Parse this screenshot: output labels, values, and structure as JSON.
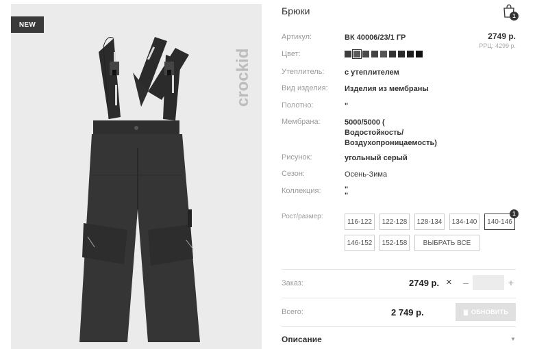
{
  "badge": "NEW",
  "brand_logo": "crockid",
  "product": {
    "title": "Брюки",
    "cart_count": "1",
    "price": "2749 р.",
    "rrp": "РРЦ: 4299 р."
  },
  "specs": [
    {
      "label": "Артикул:",
      "value": "ВК 40006/23/1 ГР"
    },
    {
      "label": "Цвет:",
      "value": ""
    },
    {
      "label": "Утеплитель:",
      "value": "с утеплителем"
    },
    {
      "label": "Вид изделия:",
      "value": "Изделия из мембраны"
    },
    {
      "label": "Полотно:",
      "value": "\""
    },
    {
      "label": "Мембрана:",
      "value": "5000/5000 ( Водостойкость/ Воздухопроницаемость)"
    },
    {
      "label": "Рисунок:",
      "value": "угольный серый"
    },
    {
      "label": "Сезон:",
      "value": "Осень-Зима"
    },
    {
      "label": "Коллекция:",
      "value": "\" \""
    }
  ],
  "color_swatches": [
    "#3c3c3c",
    "#5a5a5a",
    "#4a4a4a",
    "#444444",
    "#555555",
    "#333333",
    "#2a2a2a",
    "#1e1e1e",
    "#111111"
  ],
  "sizes": {
    "label": "Рост/размер:",
    "options": [
      "116-122",
      "122-128",
      "128-134",
      "134-140",
      "140-146",
      "146-152",
      "152-158"
    ],
    "selected": "140-146",
    "selected_count": "1",
    "select_all": "ВЫБРАТЬ ВСЕ"
  },
  "order": {
    "label": "Заказ:",
    "price": "2749 р.",
    "times": "×",
    "minus": "–",
    "plus": "+",
    "qty": ""
  },
  "total": {
    "label": "Всего:",
    "value": "2 749 р.",
    "update": "ОБНОВИТЬ"
  },
  "description": {
    "label": "Описание",
    "chevron": "▼"
  }
}
